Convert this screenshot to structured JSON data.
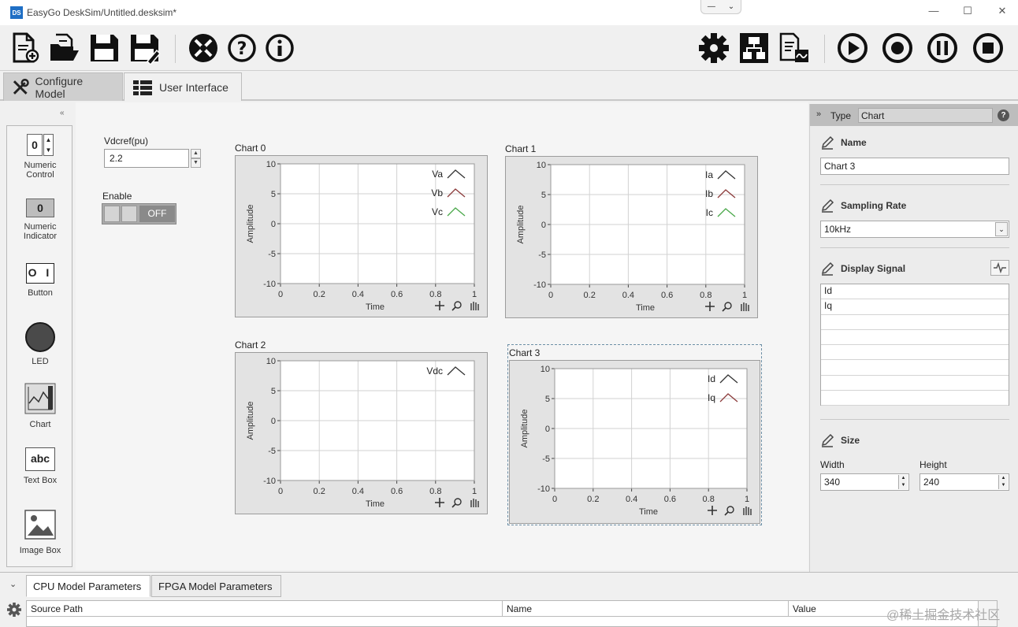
{
  "window": {
    "app_icon_text": "DS",
    "title": "EasyGo DeskSim/Untitled.desksim*",
    "collapse_glyphs": [
      "—",
      "⌄"
    ],
    "controls": {
      "minimize": "—",
      "maximize": "☐",
      "close": "✕"
    }
  },
  "toolbar": {
    "icons": [
      "new-file-icon",
      "open-folder-icon",
      "save-icon",
      "save-as-icon",
      "tools-icon",
      "help-icon",
      "info-icon",
      "settings-gear-icon",
      "network-icon",
      "report-icon",
      "run-icon",
      "record-icon",
      "pause-icon",
      "stop-icon"
    ]
  },
  "tabs": {
    "configure": "Configure Model",
    "user_interface": "User Interface",
    "active": "configure"
  },
  "palette": {
    "collapse": "«",
    "items": [
      {
        "icon": "numeric-control-icon",
        "glyph": "0",
        "label_1": "Numeric",
        "label_2": "Control"
      },
      {
        "icon": "numeric-indicator-icon",
        "glyph": "0",
        "label_1": "Numeric",
        "label_2": "Indicator"
      },
      {
        "icon": "button-icon",
        "glyph": "O I",
        "label_1": "Button",
        "label_2": ""
      },
      {
        "icon": "led-icon",
        "glyph": "",
        "label_1": "LED",
        "label_2": ""
      },
      {
        "icon": "chart-icon",
        "glyph": "",
        "label_1": "Chart",
        "label_2": ""
      },
      {
        "icon": "textbox-icon",
        "glyph": "abc",
        "label_1": "Text Box",
        "label_2": ""
      },
      {
        "icon": "imagebox-icon",
        "glyph": "",
        "label_1": "Image Box",
        "label_2": ""
      }
    ]
  },
  "canvas": {
    "vdcref": {
      "label": "Vdcref(pu)",
      "value": "2.2"
    },
    "enable": {
      "label": "Enable",
      "state": "OFF"
    },
    "charts": [
      {
        "title": "Chart 0",
        "legend": [
          "Va",
          "Vb",
          "Vc"
        ],
        "legend_colors": [
          "#333333",
          "#8b3a3a",
          "#4aa84a"
        ],
        "selected": false
      },
      {
        "title": "Chart 1",
        "legend": [
          "Ia",
          "Ib",
          "Ic"
        ],
        "legend_colors": [
          "#333333",
          "#8b3a3a",
          "#4aa84a"
        ],
        "selected": false
      },
      {
        "title": "Chart 2",
        "legend": [
          "Vdc"
        ],
        "legend_colors": [
          "#333333"
        ],
        "selected": false
      },
      {
        "title": "Chart 3",
        "legend": [
          "Id",
          "Iq"
        ],
        "legend_colors": [
          "#333333",
          "#8b3a3a"
        ],
        "selected": true
      }
    ],
    "axes": {
      "ylabel": "Amplitude",
      "xlabel": "Time",
      "yticks": [
        "10",
        "5",
        "0",
        "-5",
        "-10"
      ],
      "xticks": [
        "0",
        "0.2",
        "0.4",
        "0.6",
        "0.8",
        "1"
      ]
    }
  },
  "properties": {
    "collapse": "»",
    "type_label": "Type",
    "type_value": "Chart",
    "help": "?",
    "name_label": "Name",
    "name_value": "Chart 3",
    "sampling_label": "Sampling Rate",
    "sampling_value": "10kHz",
    "display_label": "Display Signal",
    "signals": [
      "Id",
      "Iq",
      "",
      "",
      "",
      "",
      "",
      ""
    ],
    "size_label": "Size",
    "width_label": "Width",
    "width_value": "340",
    "height_label": "Height",
    "height_value": "240"
  },
  "bottom": {
    "collapse": "⌄",
    "tab_cpu": "CPU Model Parameters",
    "tab_fpga": "FPGA Model Parameters",
    "columns": [
      "Source Path",
      "Name",
      "Value"
    ]
  },
  "watermark": "@稀土掘金技术社区"
}
